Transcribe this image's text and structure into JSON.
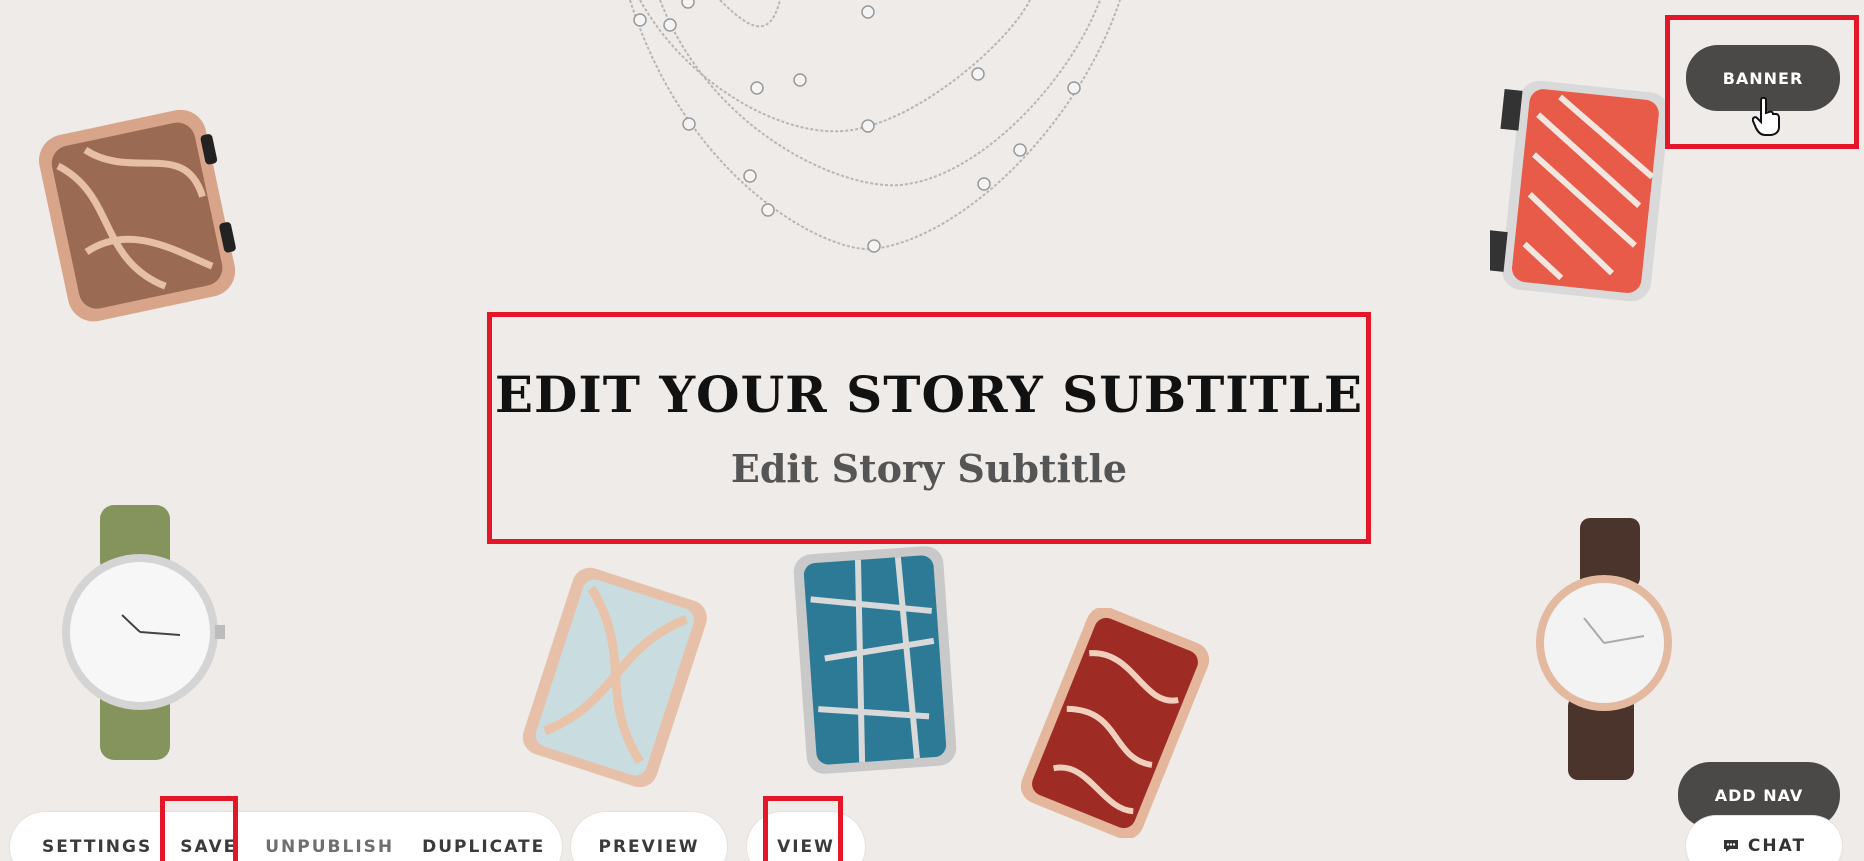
{
  "hero": {
    "title": "EDIT YOUR STORY SUBTITLE",
    "subtitle": "Edit Story Subtitle"
  },
  "buttons": {
    "banner": "BANNER",
    "add_nav": "ADD NAV",
    "chat": "CHAT"
  },
  "toolbar": {
    "settings": "SETTINGS",
    "save": "SAVE",
    "unpublish": "UNPUBLISH",
    "duplicate": "DUPLICATE",
    "preview": "PREVIEW",
    "view": "VIEW"
  },
  "colors": {
    "background": "#efebe8",
    "highlight": "#e3162a",
    "pill": "#4a4947"
  },
  "icons": [
    "chat-bubble-icon",
    "hand-cursor-icon"
  ]
}
